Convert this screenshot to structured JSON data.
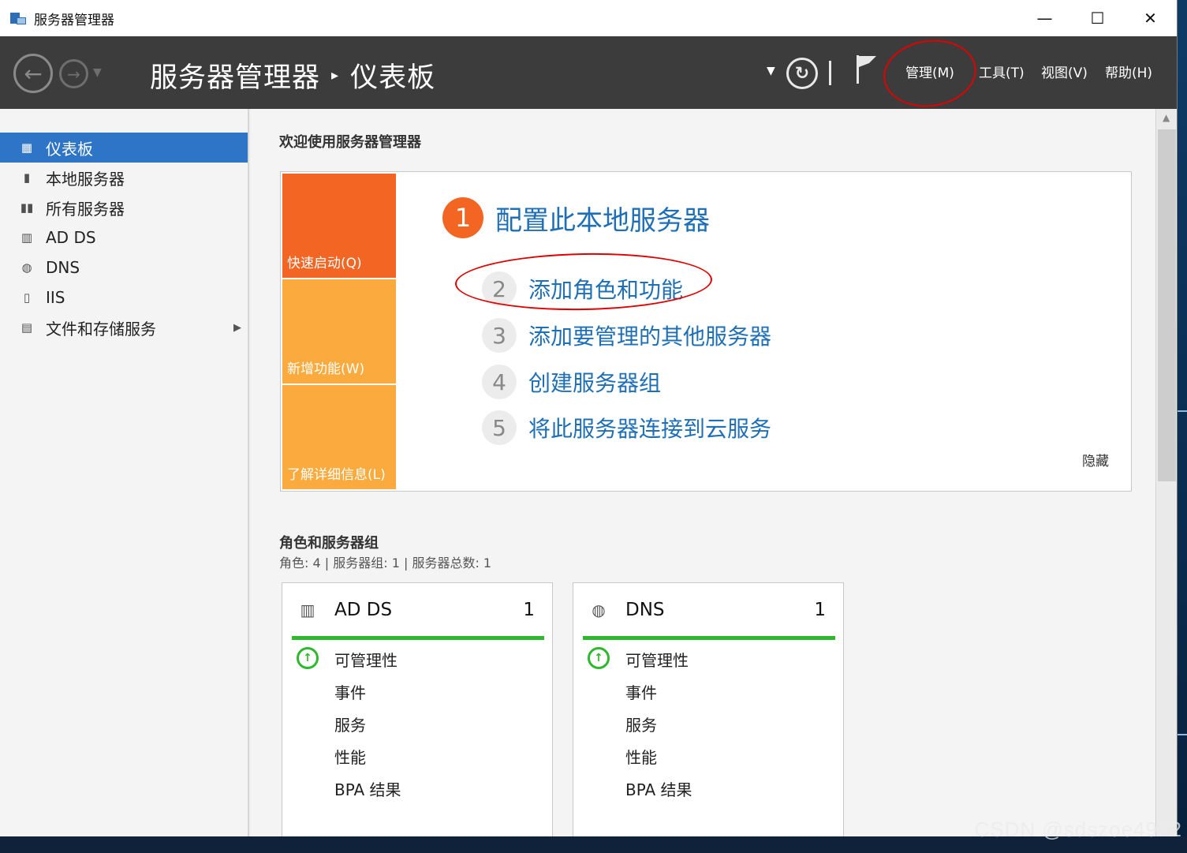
{
  "window": {
    "title": "服务器管理器",
    "minimize": "—",
    "maximize": "☐",
    "close": "✕"
  },
  "header": {
    "breadcrumb_root": "服务器管理器",
    "breadcrumb_sep": "▸",
    "breadcrumb_current": "仪表板",
    "menus": {
      "manage": "管理(M)",
      "tools": "工具(T)",
      "view": "视图(V)",
      "help": "帮助(H)"
    }
  },
  "sidebar": {
    "items": [
      {
        "label": "仪表板",
        "icon": "dashboard-icon",
        "active": true
      },
      {
        "label": "本地服务器",
        "icon": "server-icon"
      },
      {
        "label": "所有服务器",
        "icon": "servers-icon"
      },
      {
        "label": "AD DS",
        "icon": "adds-icon"
      },
      {
        "label": "DNS",
        "icon": "dns-icon"
      },
      {
        "label": "IIS",
        "icon": "iis-icon"
      },
      {
        "label": "文件和存储服务",
        "icon": "file-storage-icon",
        "has_arrow": true
      }
    ]
  },
  "welcome": {
    "title": "欢迎使用服务器管理器",
    "tiles": {
      "quick_start": "快速启动(Q)",
      "whats_new": "新增功能(W)",
      "learn_more": "了解详细信息(L)"
    },
    "steps": [
      {
        "num": "1",
        "label": "配置此本地服务器"
      },
      {
        "num": "2",
        "label": "添加角色和功能"
      },
      {
        "num": "3",
        "label": "添加要管理的其他服务器"
      },
      {
        "num": "4",
        "label": "创建服务器组"
      },
      {
        "num": "5",
        "label": "将此服务器连接到云服务"
      }
    ],
    "hide": "隐藏"
  },
  "roles": {
    "title": "角色和服务器组",
    "subtitle": "角色: 4 | 服务器组: 1 | 服务器总数: 1",
    "cards": [
      {
        "name": "AD DS",
        "count": "1",
        "icon": "adds-icon",
        "rows": [
          "可管理性",
          "事件",
          "服务",
          "性能",
          "BPA 结果"
        ]
      },
      {
        "name": "DNS",
        "count": "1",
        "icon": "dns-icon",
        "rows": [
          "可管理性",
          "事件",
          "服务",
          "性能",
          "BPA 结果"
        ]
      }
    ]
  },
  "watermark": "CSDN @sdszoe4922",
  "colors": {
    "accent": "#2e75c8",
    "orange": "#f26522",
    "amber": "#fbab3e",
    "link": "#1f6fb6",
    "header_bg": "#3c3c3c",
    "status_ok": "#2db82d",
    "annotation": "#e00000"
  }
}
